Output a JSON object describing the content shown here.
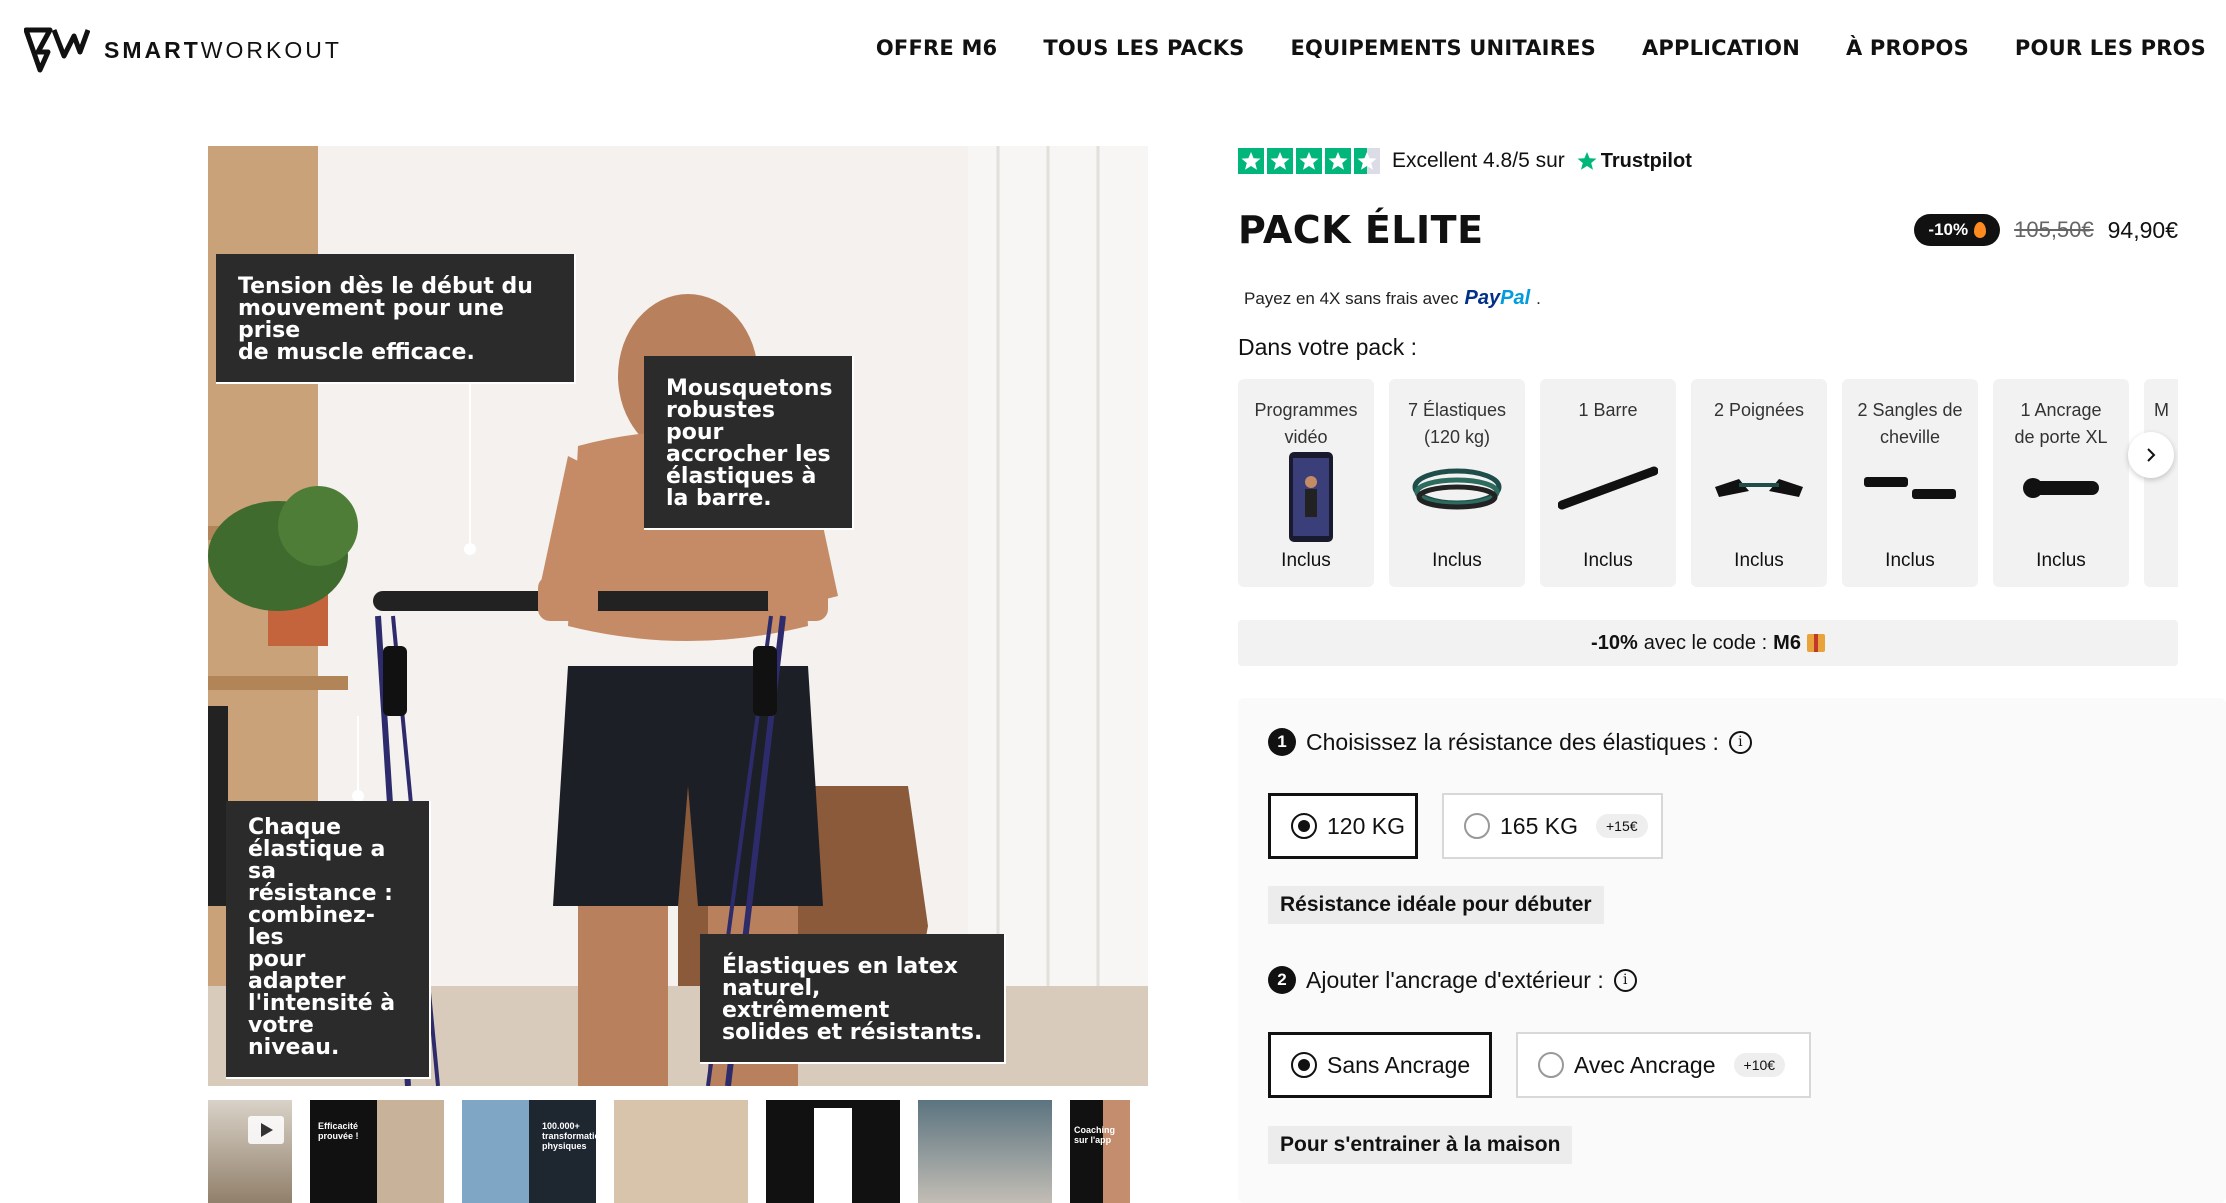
{
  "brand": {
    "name_bold": "SMART",
    "name_light": "WORKOUT"
  },
  "nav": [
    "OFFRE M6",
    "TOUS LES PACKS",
    "EQUIPEMENTS UNITAIRES",
    "APPLICATION",
    "À PROPOS",
    "POUR LES PROS"
  ],
  "hero": {
    "callouts": [
      [
        "Tension dès le début du",
        "mouvement pour une prise",
        "de muscle efficace."
      ],
      [
        "Mousquetons",
        "robustes pour",
        "accrocher les",
        "élastiques à",
        "la barre."
      ],
      [
        "Chaque",
        "élastique a sa",
        "résistance :",
        "combinez-les",
        "pour adapter",
        "l'intensité à",
        "votre niveau."
      ],
      [
        "Élastiques en latex",
        "naturel, extrêmement",
        "solides et résistants."
      ]
    ]
  },
  "thumbnails": [
    {
      "text": ""
    },
    {
      "text": "Efficacité prouvée !"
    },
    {
      "text": "100.000+ transformations physiques"
    },
    {
      "text": ""
    },
    {
      "text": ""
    },
    {
      "text": ""
    },
    {
      "text": "Coaching sur l'app"
    }
  ],
  "trustpilot": {
    "text": "Excellent 4.8/5 sur",
    "brand": "Trustpilot",
    "rating": 4.5
  },
  "product": {
    "title": "PACK ÉLITE",
    "discount_badge": "-10%",
    "old_price": "105,50€",
    "price": "94,90€",
    "paypal_text": "Payez en 4X sans frais avec",
    "paypal_word1": "Pay",
    "paypal_word2": "Pal",
    "pack_label": "Dans votre pack :"
  },
  "pack_items": [
    {
      "line1": "Programmes",
      "line2": "vidéo",
      "status": "Inclus",
      "icon": "phone-icon"
    },
    {
      "line1": "7 Élastiques",
      "line2": "(120 kg)",
      "status": "Inclus",
      "icon": "bands-icon"
    },
    {
      "line1": "1 Barre",
      "line2": "",
      "status": "Inclus",
      "icon": "bar-icon"
    },
    {
      "line1": "2 Poignées",
      "line2": "",
      "status": "Inclus",
      "icon": "handles-icon"
    },
    {
      "line1": "2 Sangles de",
      "line2": "cheville",
      "status": "Inclus",
      "icon": "straps-icon"
    },
    {
      "line1": "1 Ancrage",
      "line2": "de porte XL",
      "status": "Inclus",
      "icon": "anchor-icon"
    },
    {
      "line1": "M",
      "line2": "",
      "status": "",
      "icon": ""
    }
  ],
  "promo": {
    "prefix": "-10%",
    "middle": "avec le code :",
    "code": "M6"
  },
  "step1": {
    "num": "1",
    "label": "Choisissez la résistance des élastiques :",
    "options": [
      {
        "label": "120 KG",
        "extra": "",
        "selected": true
      },
      {
        "label": "165 KG",
        "extra": "+15€",
        "selected": false
      }
    ],
    "hint": "Résistance idéale pour débuter"
  },
  "step2": {
    "num": "2",
    "label": "Ajouter l'ancrage d'extérieur :",
    "options": [
      {
        "label": "Sans Ancrage",
        "extra": "",
        "selected": true
      },
      {
        "label": "Avec Ancrage",
        "extra": "+10€",
        "selected": false
      }
    ],
    "hint": "Pour s'entrainer à la maison"
  },
  "colors": {
    "trustpilot_green": "#00b67a",
    "paypal_dark": "#003087",
    "paypal_light": "#009cde"
  }
}
